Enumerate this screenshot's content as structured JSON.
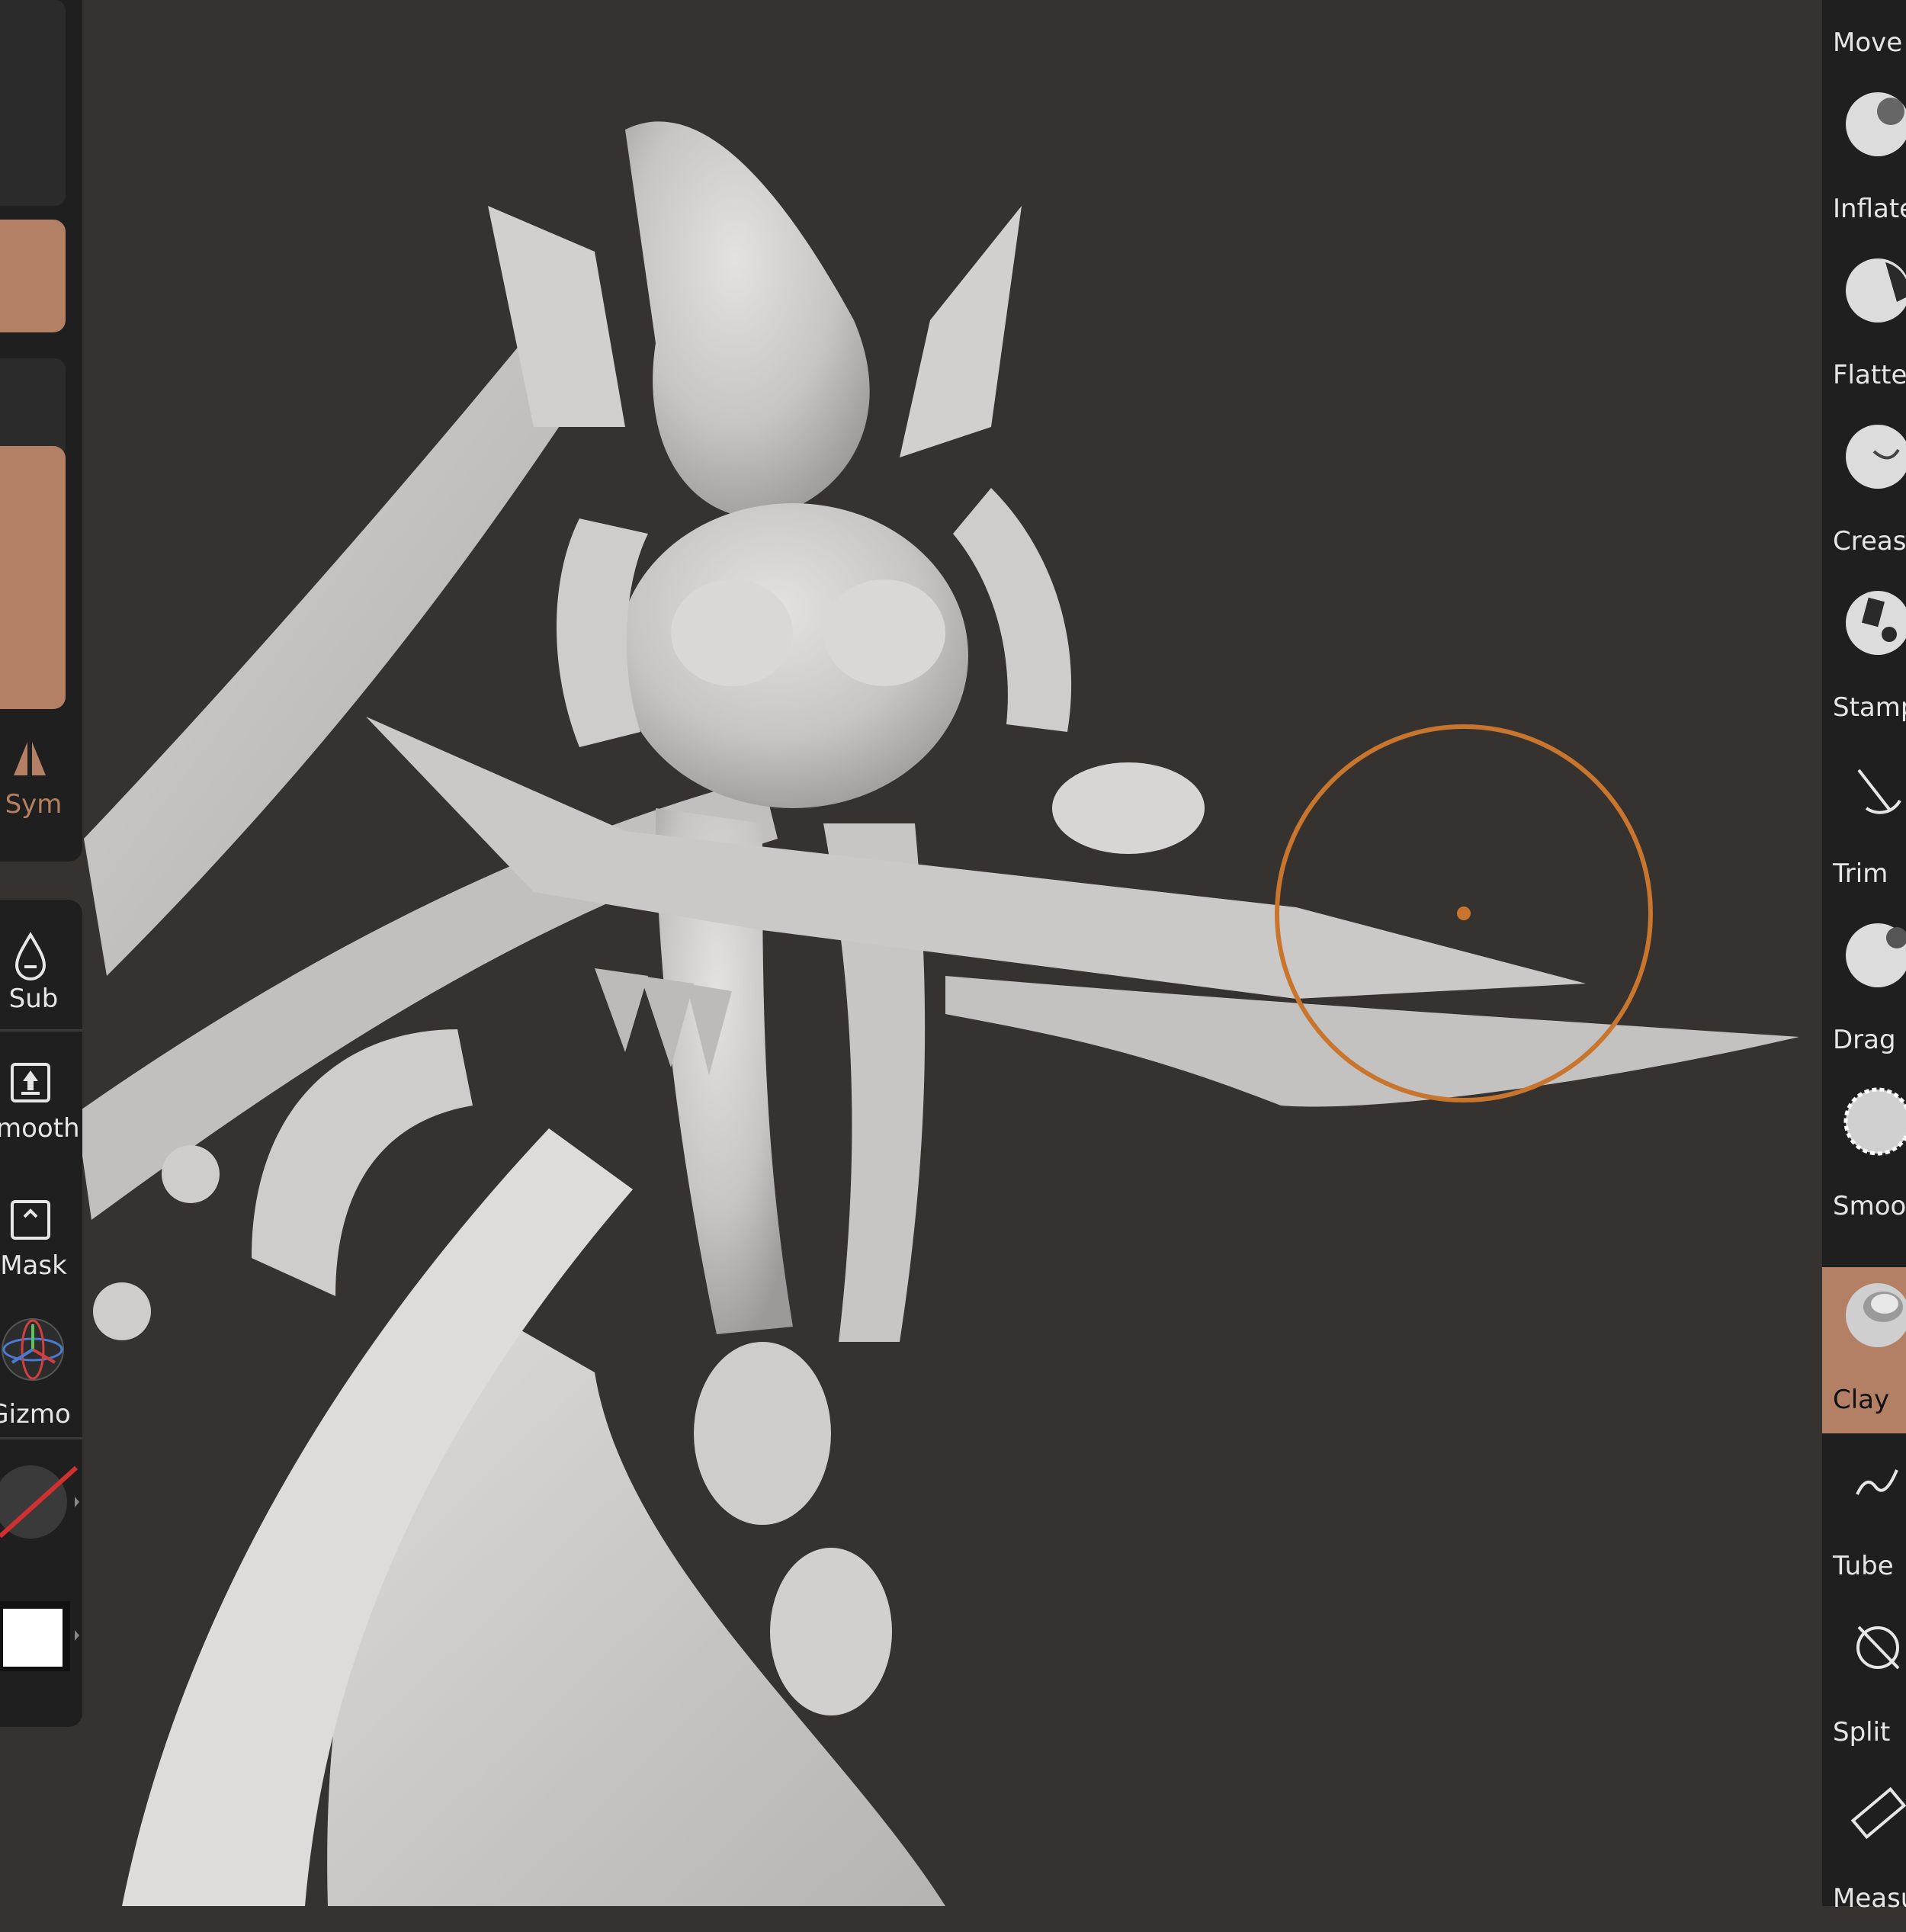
{
  "left_toolbar": {
    "sym_label": "Sym",
    "sub_label": "Sub",
    "smooth_label": "Smooth",
    "mask_label": "Mask",
    "gizmo_label": "Gizmo"
  },
  "brush_tools": [
    {
      "label": "Move",
      "icon": "move-sphere-icon",
      "active": false
    },
    {
      "label": "Inflate",
      "icon": "inflate-sphere-icon",
      "active": false
    },
    {
      "label": "Flatten",
      "icon": "flatten-sphere-icon",
      "active": false
    },
    {
      "label": "Crease",
      "icon": "crease-sphere-icon",
      "active": false
    },
    {
      "label": "Stamp",
      "icon": "stamp-sphere-icon",
      "active": false
    },
    {
      "label": "Trim",
      "icon": "trim-icon",
      "active": false
    },
    {
      "label": "Drag",
      "icon": "drag-sphere-icon",
      "active": false
    },
    {
      "label": "Smooth",
      "icon": "smooth-sphere-icon",
      "active": false
    },
    {
      "label": "Clay",
      "icon": "clay-sphere-icon",
      "active": true
    },
    {
      "label": "Tube",
      "icon": "tube-curve-icon",
      "active": false
    },
    {
      "label": "Split",
      "icon": "split-icon",
      "active": false
    },
    {
      "label": "Measure",
      "icon": "ruler-icon",
      "active": false
    }
  ],
  "colors": {
    "accent": "#b38066",
    "panel_bg": "#1f1f1f",
    "viewport_bg": "#363230",
    "brush_cursor": "#c8752e",
    "model_base": "#c9c7c5"
  }
}
